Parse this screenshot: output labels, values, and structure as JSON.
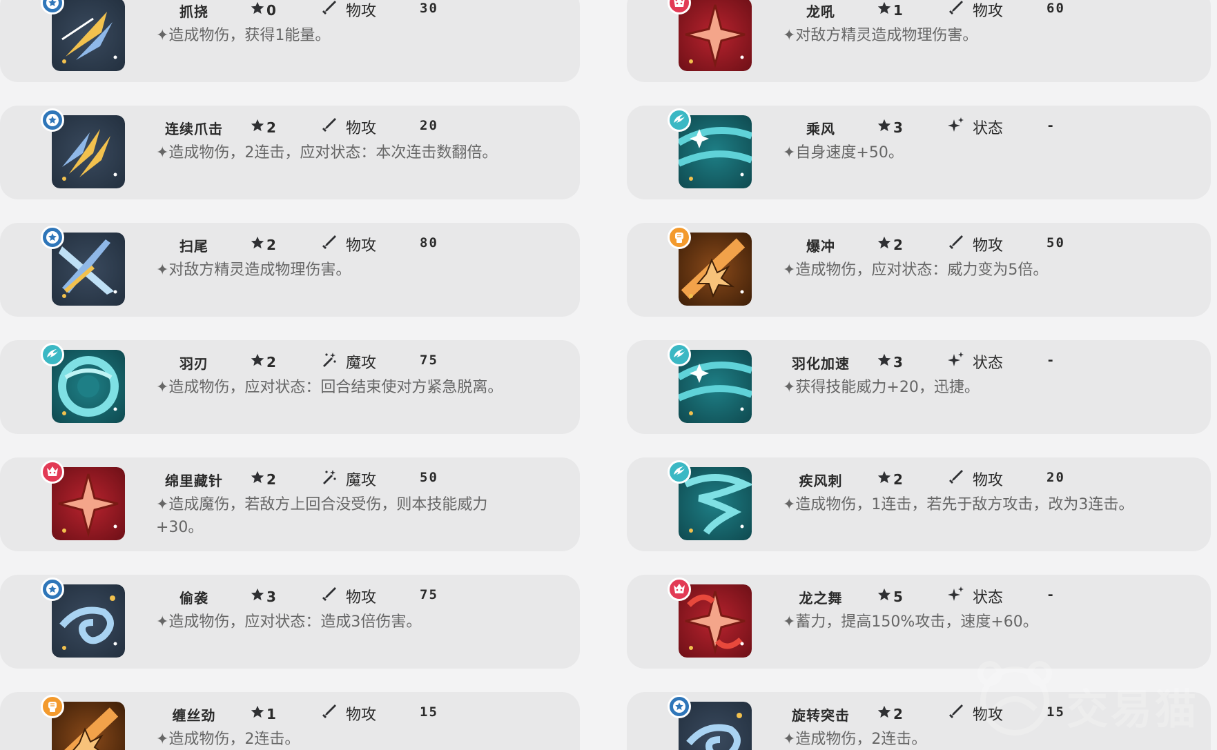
{
  "colors": {
    "page_bg": "#f3f3f4",
    "card_bg": "#e8e8e9",
    "text_dark": "#2a2a2a",
    "text_desc": "#666666",
    "badge_normal": "#2f76b9",
    "badge_dragon": "#e23a55",
    "badge_wing": "#3bb8c4",
    "badge_fighting": "#f39a2d"
  },
  "skills": [
    {
      "name": "抓挠",
      "cost": "0",
      "category": "物攻",
      "category_icon": "sword-icon",
      "power": "30",
      "desc": "✦造成物伤，获得1能量。",
      "type": "normal",
      "badge_icon": "star-badge-icon",
      "art": "slash-yellow"
    },
    {
      "name": "龙吼",
      "cost": "1",
      "category": "物攻",
      "category_icon": "sword-icon",
      "power": "60",
      "desc": "✦对敌方精灵造成物理伤害。",
      "type": "dragon",
      "badge_icon": "dragon-badge-icon",
      "art": "burst-red"
    },
    {
      "name": "连续爪击",
      "cost": "2",
      "category": "物攻",
      "category_icon": "sword-icon",
      "power": "20",
      "desc": "✦造成物伤，2连击，应对状态：本次连击数翻倍。",
      "type": "normal",
      "badge_icon": "star-badge-icon",
      "art": "claws-yellow"
    },
    {
      "name": "乘风",
      "cost": "3",
      "category": "状态",
      "category_icon": "sparkle-icon",
      "power": "-",
      "desc": "✦自身速度+50。",
      "type": "wing",
      "badge_icon": "wing-badge-icon",
      "art": "wind-teal"
    },
    {
      "name": "扫尾",
      "cost": "2",
      "category": "物攻",
      "category_icon": "sword-icon",
      "power": "80",
      "desc": "✦对敌方精灵造成物理伤害。",
      "type": "normal",
      "badge_icon": "star-badge-icon",
      "art": "cross-blue"
    },
    {
      "name": "爆冲",
      "cost": "2",
      "category": "物攻",
      "category_icon": "sword-icon",
      "power": "50",
      "desc": "✦造成物伤，应对状态：威力变为5倍。",
      "type": "fighting",
      "badge_icon": "fist-badge-icon",
      "art": "impact-orange"
    },
    {
      "name": "羽刃",
      "cost": "2",
      "category": "魔攻",
      "category_icon": "magic-icon",
      "power": "75",
      "desc": "✦造成物伤，应对状态：回合结束使对方紧急脱离。",
      "type": "wing",
      "badge_icon": "wing-badge-icon",
      "art": "swirl-teal"
    },
    {
      "name": "羽化加速",
      "cost": "3",
      "category": "状态",
      "category_icon": "sparkle-icon",
      "power": "-",
      "desc": "✦获得技能威力+20，迅捷。",
      "type": "wing",
      "badge_icon": "wing-badge-icon",
      "art": "wind-teal"
    },
    {
      "name": "绵里藏针",
      "cost": "2",
      "category": "魔攻",
      "category_icon": "magic-icon",
      "power": "50",
      "desc": "✦造成魔伤，若敌方上回合没受伤，则本技能威力+30。",
      "type": "dragon",
      "badge_icon": "dragon-badge-icon",
      "art": "burst-red"
    },
    {
      "name": "疾风刺",
      "cost": "2",
      "category": "物攻",
      "category_icon": "sword-icon",
      "power": "20",
      "desc": "✦造成物伤，1连击，若先于敌方攻击，改为3连击。",
      "type": "wing",
      "badge_icon": "wing-badge-icon",
      "art": "tornado-teal"
    },
    {
      "name": "偷袭",
      "cost": "3",
      "category": "物攻",
      "category_icon": "sword-icon",
      "power": "75",
      "desc": "✦造成物伤，应对状态：造成3倍伤害。",
      "type": "normal",
      "badge_icon": "star-badge-icon",
      "art": "spiral-blue"
    },
    {
      "name": "龙之舞",
      "cost": "5",
      "category": "状态",
      "category_icon": "sparkle-icon",
      "power": "-",
      "desc": "✦蓄力，提高150%攻击，速度+60。",
      "type": "dragon",
      "badge_icon": "dragon-badge-icon",
      "art": "dance-red"
    },
    {
      "name": "缠丝劲",
      "cost": "1",
      "category": "物攻",
      "category_icon": "sword-icon",
      "power": "15",
      "desc": "✦造成物伤，2连击。",
      "type": "fighting",
      "badge_icon": "fist-badge-icon",
      "art": "impact-orange"
    },
    {
      "name": "旋转突击",
      "cost": "2",
      "category": "物攻",
      "category_icon": "sword-icon",
      "power": "15",
      "desc": "✦造成物伤，2连击。",
      "type": "normal",
      "badge_icon": "star-badge-icon",
      "art": "spiral-blue"
    }
  ],
  "watermark": {
    "text": "交易猫"
  }
}
